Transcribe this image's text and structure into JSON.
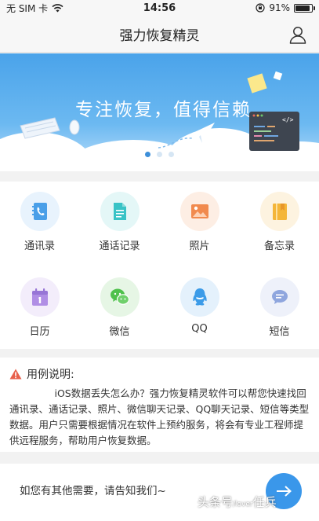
{
  "status": {
    "carrier": "无 SIM 卡",
    "time": "14:56",
    "battery": "91%",
    "battery_level": 0.91
  },
  "nav": {
    "title": "强力恢复精灵"
  },
  "banner": {
    "slogan": "专注恢复，值得信赖",
    "page_count": 3,
    "active_page": 1
  },
  "categories": [
    {
      "label": "通讯录",
      "icon": "contacts-icon",
      "color": "#4a9fe8",
      "bg": "#e8f3fd"
    },
    {
      "label": "通话记录",
      "icon": "call-log-icon",
      "color": "#39c3c6",
      "bg": "#e4f7f7"
    },
    {
      "label": "照片",
      "icon": "photos-icon",
      "color": "#f18a4e",
      "bg": "#fdeee4"
    },
    {
      "label": "备忘录",
      "icon": "memo-icon",
      "color": "#f4b63a",
      "bg": "#fdf3e0"
    },
    {
      "label": "日历",
      "icon": "calendar-icon",
      "color": "#b08ee5",
      "bg": "#f3edfb"
    },
    {
      "label": "微信",
      "icon": "wechat-icon",
      "color": "#4fc14c",
      "bg": "#e6f6e5"
    },
    {
      "label": "QQ",
      "icon": "qq-icon",
      "color": "#3b9be8",
      "bg": "#e4f1fc"
    },
    {
      "label": "短信",
      "icon": "sms-icon",
      "color": "#8fa6de",
      "bg": "#eef1fa"
    }
  ],
  "description": {
    "heading": "用例说明:",
    "body": "iOS数据丢失怎么办？强力恢复精灵软件可以帮您快速找回通讯录、通话记录、照片、微信聊天记录、QQ聊天记录、短信等类型数据。用户只需要根据情况在软件上预约服务，将会有专业工程师提供远程服务，帮助用户恢复数据。"
  },
  "feedback": {
    "prompt": "如您有其他需要，请告知我们~"
  },
  "watermark": {
    "text": "头条号",
    "sub": "/lover",
    "name": "任兵"
  }
}
